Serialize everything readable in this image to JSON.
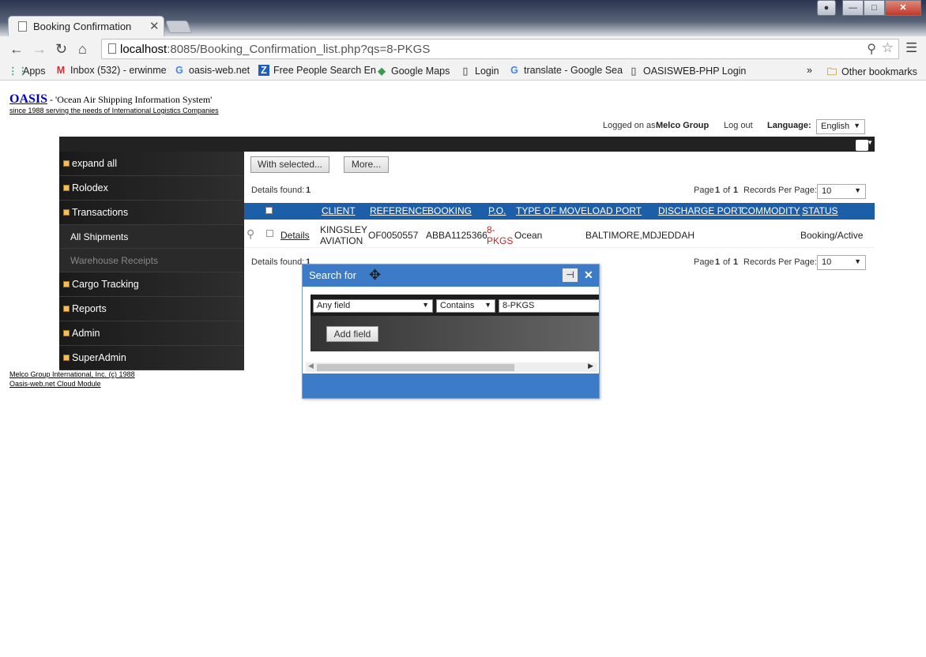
{
  "browser": {
    "tab_title": "Booking Confirmation",
    "tab_close": "✕",
    "url_host": "localhost",
    "url_rest": ":8085/Booking_Confirmation_list.php?qs=8-PKGS",
    "bookmarks": [
      {
        "icon": "apps-icon",
        "glyph": "⋮⋮",
        "label": "Apps"
      },
      {
        "icon": "gmail-icon",
        "glyph": "M",
        "label": "Inbox (532) - erwinme"
      },
      {
        "icon": "google-icon",
        "glyph": "G",
        "label": "oasis-web.net"
      },
      {
        "icon": "z-icon",
        "glyph": "Z",
        "label": "Free People Search En"
      },
      {
        "icon": "maps-icon",
        "glyph": "◆",
        "label": "Google Maps"
      },
      {
        "icon": "page-icon",
        "glyph": "▯",
        "label": "Login"
      },
      {
        "icon": "google-icon",
        "glyph": "G",
        "label": "translate - Google Sea"
      },
      {
        "icon": "page-icon",
        "glyph": "▯",
        "label": "OASISWEB-PHP Login"
      }
    ],
    "more": "»",
    "other_bookmarks": "Other bookmarks"
  },
  "header": {
    "logo": "OASIS",
    "tagline": " - 'Ocean Air Shipping Information System'",
    "subtitle": "since 1988 serving the needs of International Logistics Companies",
    "logged_prefix": "Logged on as",
    "user": "Melco Group",
    "logout": "Log out",
    "language_label": "Language:",
    "language_value": "English"
  },
  "sidebar": {
    "items": [
      {
        "label": "expand all"
      },
      {
        "label": "Rolodex"
      },
      {
        "label": "Transactions"
      },
      {
        "label": "All Shipments"
      },
      {
        "label": "Warehouse Receipts"
      },
      {
        "label": "Cargo Tracking"
      },
      {
        "label": "Reports"
      },
      {
        "label": "Admin"
      },
      {
        "label": "SuperAdmin"
      }
    ]
  },
  "content": {
    "with_selected": "With selected...",
    "more": "More...",
    "details_found_label": "Details found:",
    "details_found_count": "1",
    "page_label": "Page",
    "page_num": "1",
    "page_of": "of",
    "page_total": "1",
    "rpp_label": "Records Per Page:",
    "rpp_value": "10",
    "columns": [
      "CLIENT",
      "REFERENCE",
      "BOOKING",
      "P.O.",
      "TYPE OF MOVE",
      "LOAD PORT",
      "DISCHARGE PORT",
      "COMMODITY",
      "STATUS"
    ],
    "row": {
      "details": "Details",
      "client_1": "KINGSLEY",
      "client_2": "AVIATION",
      "reference": "OF0050557",
      "booking": "ABBA1125366",
      "po_1": "8-",
      "po_2": "PKGS",
      "type_of_move": "Ocean",
      "load_port": "BALTIMORE,MD",
      "discharge_port": "JEDDAH",
      "commodity": "",
      "status": "Booking/Active"
    },
    "bottom_details_label": "Details found:",
    "bottom_details_count": "1"
  },
  "dialog": {
    "title": "Search for",
    "close": "✕",
    "field_select": "Any field",
    "op_select": "Contains",
    "value": "8-PKGS",
    "add_field": "Add field"
  },
  "footer": {
    "line1": "Melco Group International, Inc. (c) 1988",
    "line2": "Oasis-web.net Cloud Module"
  },
  "colors": {
    "accent_blue": "#1d5ea8",
    "dialog_blue": "#3b7bc8",
    "po_red": "#cc2222",
    "sidebar_dark": "#1c1c1c"
  }
}
